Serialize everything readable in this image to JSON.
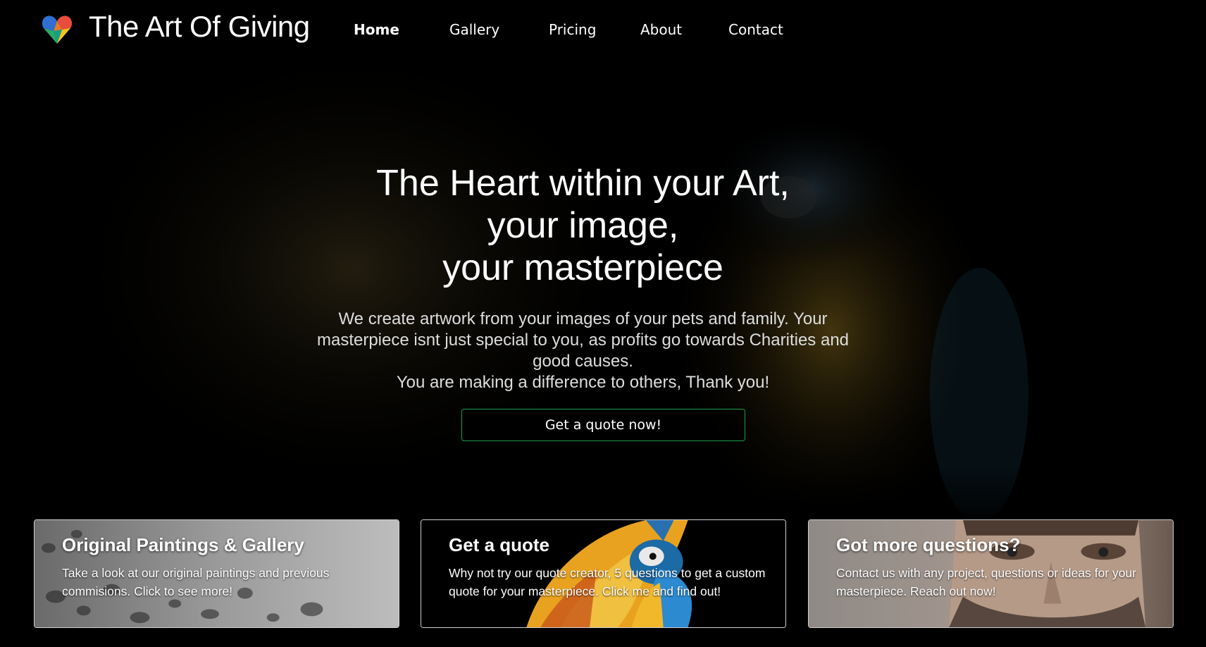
{
  "brand": {
    "name": "The Art Of Giving",
    "logo_icon": "rainbow-heart-icon"
  },
  "nav": {
    "items": [
      {
        "label": "Home",
        "active": true
      },
      {
        "label": "Gallery"
      },
      {
        "label": "Pricing"
      },
      {
        "label": "About"
      },
      {
        "label": "Contact"
      }
    ]
  },
  "hero": {
    "title_lines": [
      "The Heart within your Art,",
      "your image,",
      "your masterpiece"
    ],
    "subtitle": "We create artwork from your images of your pets and family. Your masterpiece isnt just special to you, as profits go towards Charities and good causes.",
    "thanks": "You are making a difference to others, Thank you!",
    "cta_label": "Get a quote now!"
  },
  "cards": [
    {
      "title": "Original Paintings & Gallery",
      "description": "Take a look at our original paintings and previous commisions. Click to see more!"
    },
    {
      "title": "Get a quote",
      "description": "Why not try our quote creator, 5 questions to get a custom quote for your masterpiece. Click me and find out!"
    },
    {
      "title": "Got more questions?",
      "description": "Contact us with any project, questions or ideas for your masterpiece. Reach out now!"
    }
  ],
  "colors": {
    "background": "#000000",
    "cta_border": "#1e9e4e",
    "text": "#ffffff"
  }
}
